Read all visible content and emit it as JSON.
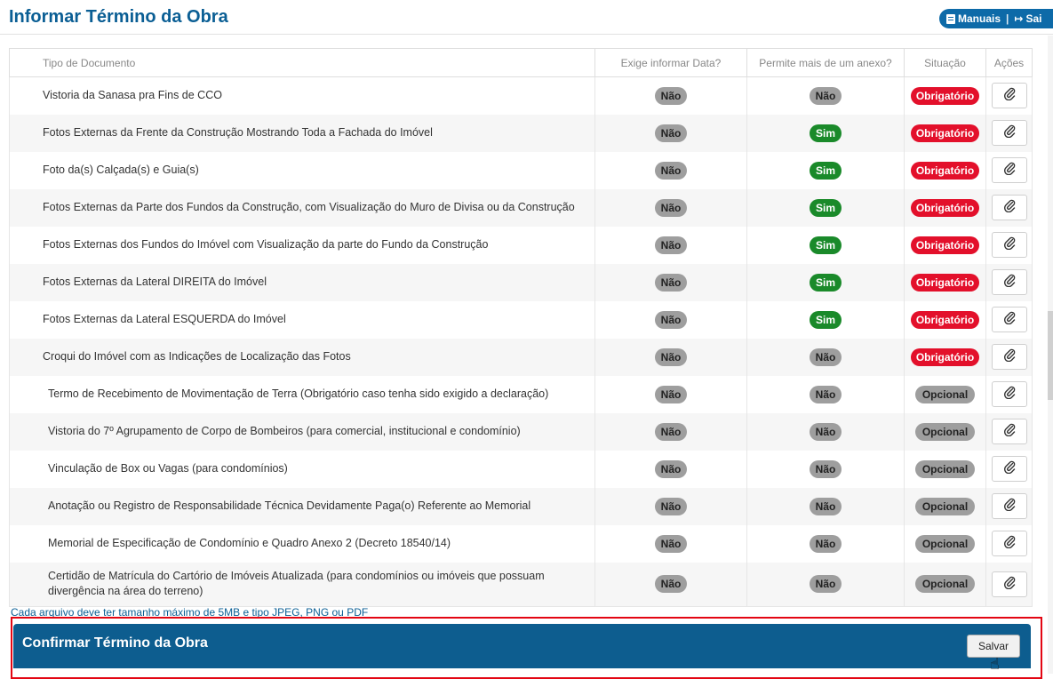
{
  "header": {
    "title": "Informar Término da Obra",
    "manuals_label": "Manuais",
    "separator": "|",
    "exit_label": "Sai"
  },
  "table": {
    "columns": {
      "doc": "Tipo de Documento",
      "exige": "Exige informar Data?",
      "permite": "Permite mais de um anexo?",
      "situacao": "Situação",
      "acoes": "Ações"
    },
    "rows": [
      {
        "doc": "Vistoria da Sanasa pra Fins de CCO",
        "exige": "Não",
        "permite": "Não",
        "situacao": "Obrigatório"
      },
      {
        "doc": "Fotos Externas da Frente da Construção Mostrando Toda a Fachada do Imóvel",
        "exige": "Não",
        "permite": "Sim",
        "situacao": "Obrigatório"
      },
      {
        "doc": "Foto da(s) Calçada(s) e Guia(s)",
        "exige": "Não",
        "permite": "Sim",
        "situacao": "Obrigatório"
      },
      {
        "doc": "Fotos Externas da Parte dos Fundos da Construção, com Visualização do Muro de Divisa ou da Construção",
        "exige": "Não",
        "permite": "Sim",
        "situacao": "Obrigatório"
      },
      {
        "doc": "Fotos Externas dos Fundos do Imóvel com Visualização da parte do Fundo da Construção",
        "exige": "Não",
        "permite": "Sim",
        "situacao": "Obrigatório"
      },
      {
        "doc": "Fotos Externas da Lateral DIREITA do Imóvel",
        "exige": "Não",
        "permite": "Sim",
        "situacao": "Obrigatório"
      },
      {
        "doc": "Fotos Externas da Lateral ESQUERDA do Imóvel",
        "exige": "Não",
        "permite": "Sim",
        "situacao": "Obrigatório"
      },
      {
        "doc": "Croqui do Imóvel com as Indicações de Localização das Fotos",
        "exige": "Não",
        "permite": "Não",
        "situacao": "Obrigatório"
      },
      {
        "doc": "Termo de Recebimento de Movimentação de Terra (Obrigatório caso tenha sido exigido a declaração)",
        "exige": "Não",
        "permite": "Não",
        "situacao": "Opcional"
      },
      {
        "doc": "Vistoria do 7º Agrupamento de Corpo de Bombeiros (para comercial, institucional e condomínio)",
        "exige": "Não",
        "permite": "Não",
        "situacao": "Opcional"
      },
      {
        "doc": "Vinculação de Box ou Vagas (para condomínios)",
        "exige": "Não",
        "permite": "Não",
        "situacao": "Opcional"
      },
      {
        "doc": "Anotação ou Registro de Responsabilidade Técnica Devidamente Paga(o) Referente ao Memorial",
        "exige": "Não",
        "permite": "Não",
        "situacao": "Opcional"
      },
      {
        "doc": "Memorial de Especificação de Condomínio e Quadro Anexo 2 (Decreto 18540/14)",
        "exige": "Não",
        "permite": "Não",
        "situacao": "Opcional"
      },
      {
        "doc": "Certidão de Matrícula do Cartório de Imóveis Atualizada (para condomínios ou imóveis que possuam divergência na área do terreno)",
        "exige": "Não",
        "permite": "Não",
        "situacao": "Opcional"
      }
    ]
  },
  "note": "Cada arquivo deve ter tamanho máximo de 5MB e tipo JPEG, PNG ou PDF",
  "confirm": {
    "title": "Confirmar Término da Obra",
    "save_label": "Salvar"
  },
  "icons": {
    "attach": "paperclip-icon",
    "manuals": "book-icon",
    "exit": "sign-out-icon",
    "cursor": "hand-pointer-icon"
  },
  "colors": {
    "brand_blue": "#0d5d8f",
    "title_blue": "#0a5e94",
    "required_red": "#e3102b",
    "yes_green": "#1a8a2a",
    "neutral_gray": "#9e9e9e",
    "highlight_red": "#e30613"
  }
}
